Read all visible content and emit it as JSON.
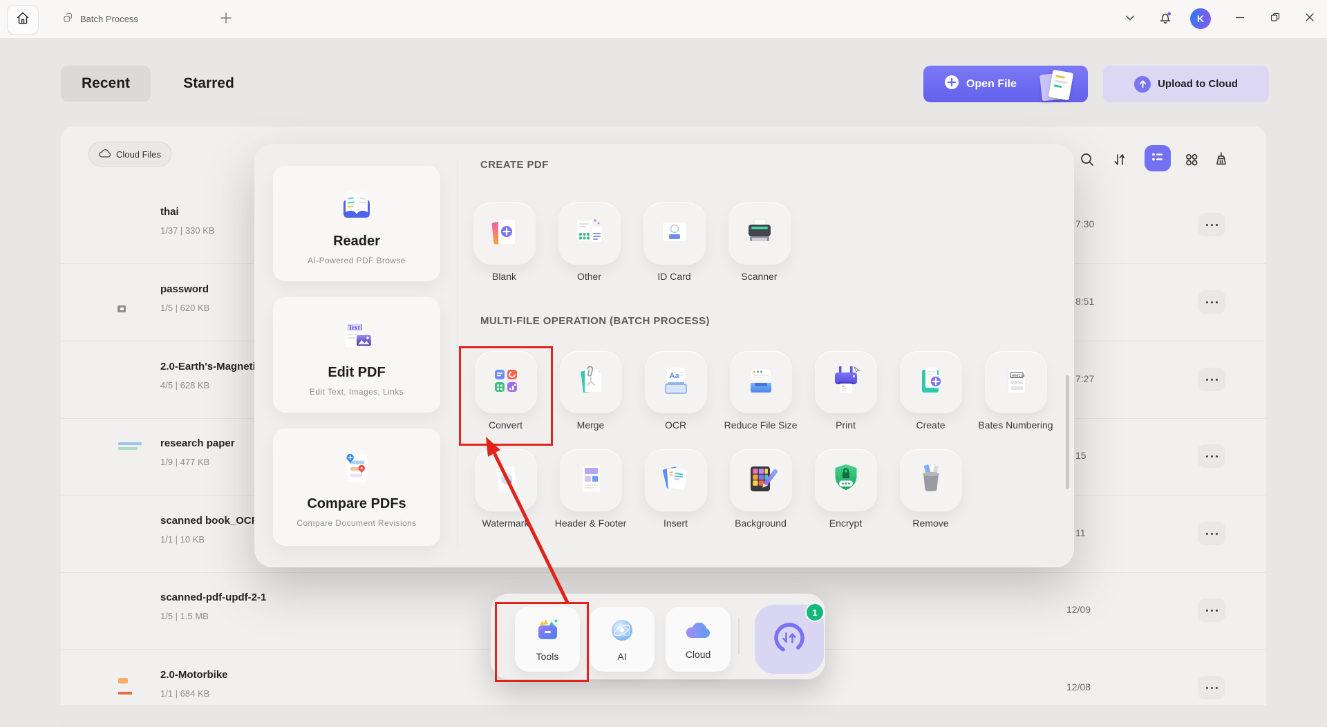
{
  "window": {
    "tab_title": "Batch Process",
    "avatar_initial": "K"
  },
  "header": {
    "tabs": [
      {
        "label": "Recent"
      },
      {
        "label": "Starred"
      }
    ],
    "open_file_label": "Open File",
    "upload_label": "Upload to Cloud"
  },
  "panel": {
    "cloud_files_label": "Cloud Files"
  },
  "files": [
    {
      "name": "thai",
      "meta": "1/37 | 330 KB",
      "date": "7:30"
    },
    {
      "name": "password",
      "meta": "1/5 | 620 KB",
      "date": "8:51"
    },
    {
      "name": "2.0-Earth's-Magneti",
      "meta": "4/5 | 628 KB",
      "date": "7:27"
    },
    {
      "name": "research paper",
      "meta": "1/9 | 477 KB",
      "date": "15"
    },
    {
      "name": "scanned book_OCR",
      "meta": "1/1 | 10 KB",
      "date": "11"
    },
    {
      "name": "scanned-pdf-updf-2-1",
      "meta": "1/5 | 1.5 MB",
      "date": "12/09"
    },
    {
      "name": "2.0-Motorbike",
      "meta": "1/1 | 684 KB",
      "date": "12/08"
    }
  ],
  "popup": {
    "cards": [
      {
        "title": "Reader",
        "subtitle": "AI-Powered PDF Browse"
      },
      {
        "title": "Edit PDF",
        "subtitle": "Edit Text, Images, Links"
      },
      {
        "title": "Compare PDFs",
        "subtitle": "Compare Document Revisions"
      }
    ],
    "create": {
      "heading": "CREATE PDF",
      "tiles": [
        "Blank",
        "Other",
        "ID Card",
        "Scanner"
      ]
    },
    "batch": {
      "heading": "MULTI-FILE OPERATION (BATCH PROCESS)",
      "row1": [
        "Convert",
        "Merge",
        "OCR",
        "Reduce File Size",
        "Print",
        "Create",
        "Bates Numbering"
      ],
      "row2": [
        "Watermark",
        "Header & Footer",
        "Insert",
        "Background",
        "Encrypt",
        "Remove"
      ]
    }
  },
  "dock": {
    "items": [
      {
        "label": "Tools"
      },
      {
        "label": "AI"
      },
      {
        "label": "Cloud"
      }
    ],
    "badge": "1"
  },
  "icon_texts": {
    "ocr": "Aa",
    "edit_pdf": "Text",
    "bates": "000123"
  },
  "colors": {
    "accent_purple": "#6f6df2",
    "annotation_red": "#e02419",
    "badge_green": "#14b87a"
  }
}
